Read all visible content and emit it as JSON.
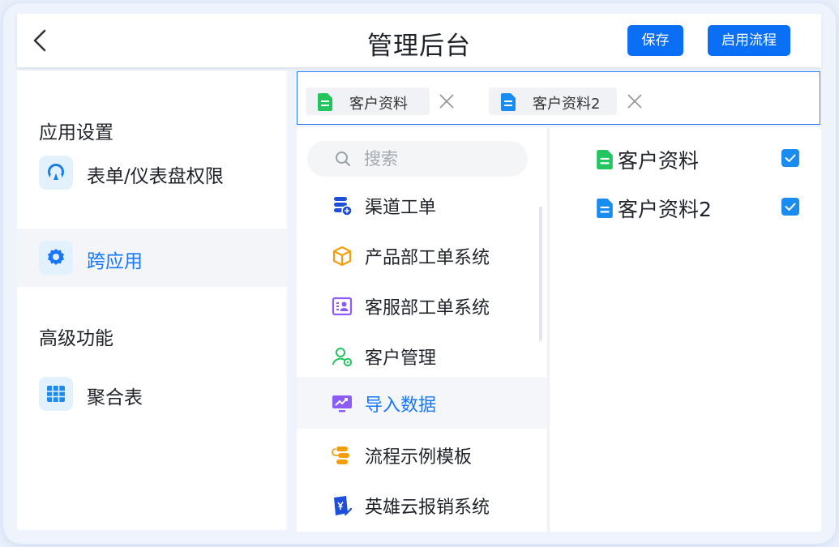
{
  "header": {
    "title": "管理后台",
    "save_label": "保存",
    "enable_flow_label": "启用流程"
  },
  "sidebar": {
    "sections": [
      {
        "title": "应用设置",
        "items": [
          {
            "label": "表单/仪表盘权限",
            "icon": "permission-icon",
            "active": false
          }
        ]
      },
      {
        "items": [
          {
            "label": "跨应用",
            "icon": "gear-icon",
            "active": true
          }
        ]
      },
      {
        "title": "高级功能",
        "items": [
          {
            "label": "聚合表",
            "icon": "table-icon",
            "active": false
          }
        ]
      }
    ]
  },
  "selected_tags": [
    {
      "label": "客户资料",
      "icon": "form-doc-icon",
      "color": "#22c55e"
    },
    {
      "label": "客户资料2",
      "icon": "form-doc-icon",
      "color": "#1a8cf0"
    }
  ],
  "search": {
    "placeholder": "搜索",
    "value": ""
  },
  "apps": [
    {
      "label": "渠道工单",
      "icon": "db-settings-icon",
      "active": false
    },
    {
      "label": "产品部工单系统",
      "icon": "box-icon",
      "active": false
    },
    {
      "label": "客服部工单系统",
      "icon": "id-card-icon",
      "active": false
    },
    {
      "label": "客户管理",
      "icon": "user-gear-icon",
      "active": false
    },
    {
      "label": "导入数据",
      "icon": "monitor-chart-icon",
      "active": true
    },
    {
      "label": "流程示例模板",
      "icon": "flow-icon",
      "active": false
    },
    {
      "label": "英雄云报销系统",
      "icon": "yen-doc-icon",
      "active": false
    }
  ],
  "forms": [
    {
      "label": "客户资料",
      "checked": true,
      "color": "#22c55e"
    },
    {
      "label": "客户资料2",
      "checked": true,
      "color": "#1a8cf0"
    }
  ],
  "colors": {
    "accent": "#0b6ff6",
    "active_text": "#1677ff",
    "checkbox": "#1a8cf0",
    "green_doc": "#22c55e",
    "blue_doc": "#1a8cf0"
  }
}
